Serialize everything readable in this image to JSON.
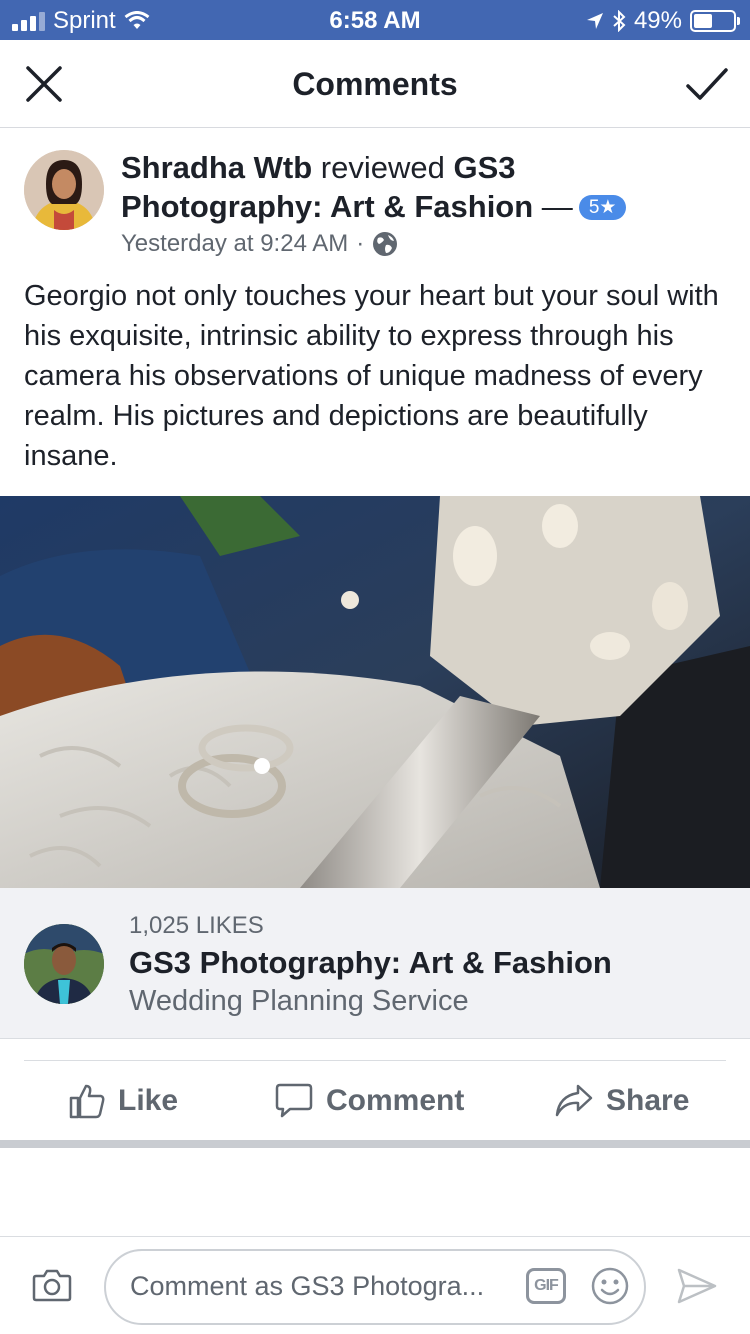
{
  "status_bar": {
    "carrier": "Sprint",
    "time": "6:58 AM",
    "battery": "49%",
    "battery_level": 0.49,
    "icons": [
      "signal-icon",
      "wifi-icon",
      "location-icon",
      "bluetooth-icon",
      "battery-icon"
    ]
  },
  "nav": {
    "title": "Comments",
    "close_icon": "close-icon",
    "done_icon": "checkmark-icon"
  },
  "post": {
    "author": "Shradha Wtb",
    "verb": " reviewed ",
    "page": "GS3 Photography: Art & Fashion",
    "dash": " —",
    "rating": "5★",
    "timestamp": "Yesterday at 9:24 AM",
    "separator": "·",
    "privacy_icon": "globe-icon",
    "body": "Georgio not only touches your heart but your soul with his exquisite, intrinsic ability to express through his camera his observations of unique madness of every realm. His pictures and depictions are beautifully insane."
  },
  "page_card": {
    "likes": "1,025 LIKES",
    "name": "GS3 Photography: Art & Fashion",
    "category": "Wedding Planning Service"
  },
  "actions": {
    "like": "Like",
    "comment": "Comment",
    "share": "Share"
  },
  "composer": {
    "placeholder": "Comment as GS3 Photogra...",
    "gif": "GIF",
    "icons": [
      "camera-icon",
      "gif-icon",
      "emoji-icon",
      "send-icon"
    ]
  },
  "colors": {
    "brand": "#4267b2",
    "rating": "#4a8be8",
    "secondary_text": "#606770",
    "card_bg": "#f1f2f5"
  }
}
